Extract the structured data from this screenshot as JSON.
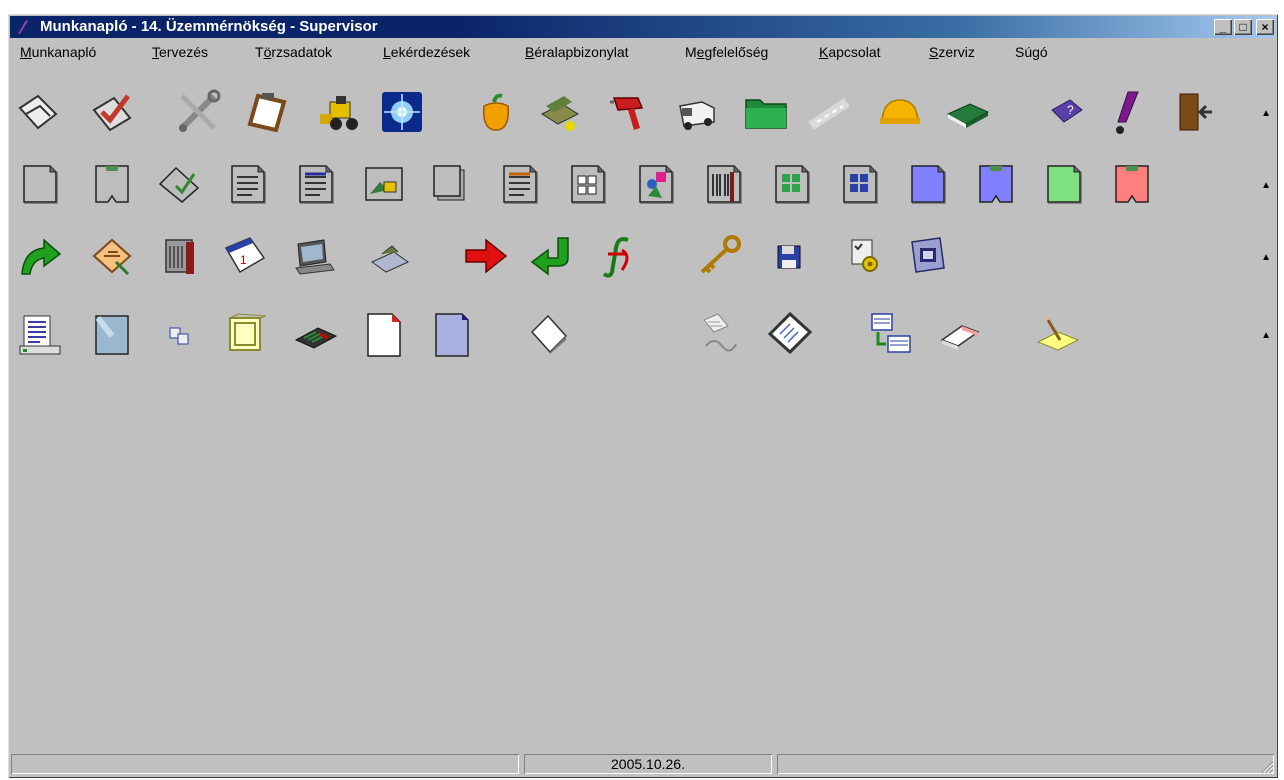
{
  "window": {
    "title": "Munkanapló - 14. Üzemmérnökség - Supervisor",
    "controls": {
      "minimize": "_",
      "maximize": "□",
      "close": "×"
    }
  },
  "menu": [
    {
      "pre": "",
      "acc": "M",
      "post": "unkanapló"
    },
    {
      "pre": "",
      "acc": "T",
      "post": "ervezés"
    },
    {
      "pre": "T",
      "acc": "ö",
      "post": "rzsadatok"
    },
    {
      "pre": "",
      "acc": "L",
      "post": "ekérdezések"
    },
    {
      "pre": "",
      "acc": "B",
      "post": "éralapbizonylat"
    },
    {
      "pre": "M",
      "acc": "e",
      "post": "gfelelőség"
    },
    {
      "pre": "",
      "acc": "K",
      "post": "apcsolat"
    },
    {
      "pre": "",
      "acc": "S",
      "post": "zerviz"
    },
    {
      "pre": "Súgó",
      "acc": "",
      "post": ""
    }
  ],
  "toolbars": [
    [
      "worklog-icon",
      "check-icon",
      "tools-icon",
      "clipboard-icon",
      "bulldozer-icon",
      "flash-icon",
      "pepper-icon",
      "scanner-icon",
      "drill-icon",
      "truck-icon",
      "folder-icon",
      "road-icon",
      "hardhat-icon",
      "book-icon",
      "help-book-icon",
      "alert-icon",
      "exit-door-icon"
    ],
    [
      "doc-gray-icon",
      "doc-tab-icon",
      "doc-check-icon",
      "doc-lines-icon",
      "doc-lines2-icon",
      "doc-image-icon",
      "doc-stack-icon",
      "doc-list-icon",
      "doc-grid-icon",
      "doc-shapes-icon",
      "doc-barcode-icon",
      "doc-green-grid-icon",
      "doc-blue-grid-icon",
      "doc-blue-icon",
      "doc-blue-tab-icon",
      "doc-green-icon",
      "doc-red-tab-icon"
    ],
    [
      "green-forward-arrow-icon",
      "certificate-icon",
      "calculator-panel-icon",
      "calendar-icon",
      "computer-icon",
      "scanner-small-icon",
      "red-arrow-icon",
      "green-return-arrow-icon",
      "function-icon",
      "key-icon",
      "floppy-save-icon",
      "settings-doc-icon",
      "folder-view-icon"
    ],
    [
      "report-list-icon",
      "blank-page-icon",
      "small-windows-icon",
      "frame-icon",
      "calculator-icon",
      "new-page-icon",
      "blue-page-icon",
      "white-sheet-icon",
      "document-link-icon",
      "notepad-icon",
      "table-transfer-icon",
      "eraser-icon",
      "pencil-note-icon"
    ]
  ],
  "statusbar": {
    "left": "",
    "date": "2005.10.26.",
    "right": ""
  }
}
